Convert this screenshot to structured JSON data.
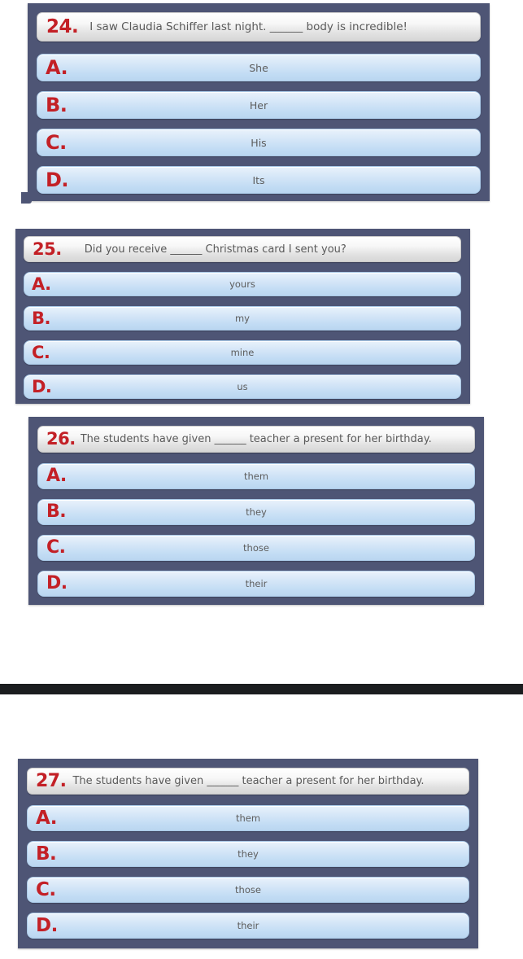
{
  "page": {
    "background_color": "#ffffff",
    "card_color": "#4e5575",
    "accent_color": "#c32026",
    "option_color": "#cfe3f7",
    "prompt_color": "#eeeeee",
    "separator_color": "#1b1d1f"
  },
  "questions": [
    {
      "number": "24.",
      "text": "I saw Claudia Schiffer last night. ______ body is incredible!",
      "options": [
        {
          "letter": "A.",
          "text": "She"
        },
        {
          "letter": "B.",
          "text": "Her"
        },
        {
          "letter": "C.",
          "text": "His"
        },
        {
          "letter": "D.",
          "text": "Its"
        }
      ]
    },
    {
      "number": "25.",
      "text": "Did you receive ______ Christmas card I sent you?",
      "options": [
        {
          "letter": "A.",
          "text": "yours"
        },
        {
          "letter": "B.",
          "text": "my"
        },
        {
          "letter": "C.",
          "text": "mine"
        },
        {
          "letter": "D.",
          "text": "us"
        }
      ]
    },
    {
      "number": "26.",
      "text": "The students have given ______ teacher a present for her birthday.",
      "options": [
        {
          "letter": "A.",
          "text": "them"
        },
        {
          "letter": "B.",
          "text": "they"
        },
        {
          "letter": "C.",
          "text": "those"
        },
        {
          "letter": "D.",
          "text": "their"
        }
      ]
    },
    {
      "number": "27.",
      "text": "The students have given ______ teacher a present for her birthday.",
      "options": [
        {
          "letter": "A.",
          "text": "them"
        },
        {
          "letter": "B.",
          "text": "they"
        },
        {
          "letter": "C.",
          "text": "those"
        },
        {
          "letter": "D.",
          "text": "their"
        }
      ]
    }
  ]
}
